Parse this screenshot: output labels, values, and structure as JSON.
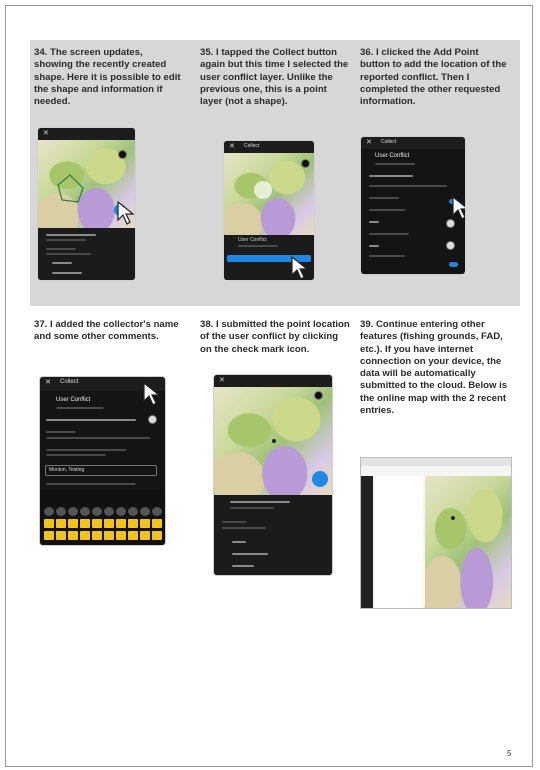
{
  "steps": [
    {
      "text": "34. The screen updates, showing the recently created shape. Here it is possible to edit the shape and information if needed."
    },
    {
      "text": "35. I tapped the Collect button again but this time I selected the user conflict layer. Unlike the previous one, this is a point layer (not a shape)."
    },
    {
      "text": "36. I clicked the Add Point button to add the location of the reported conflict. Then I completed the other requested information."
    },
    {
      "text": "37. I added the collector's name and some other comments."
    },
    {
      "text": "38. I submitted the point location of the user conflict by clicking on the check mark icon."
    },
    {
      "text": "39. Continue entering other features (fishing grounds, FAD, etc.). If you have internet connection on your device, the data will be automatically submitted to the cloud. Below is the online map with the 2 recent entries."
    }
  ],
  "screens": {
    "collect_title": "Collect",
    "user_conflict": "User Conflict",
    "close_glyph": "✕",
    "collector_value": "Monton, Testing"
  },
  "page_number": "5",
  "colors": {
    "accent": "#1e88e5",
    "band": "#d7d7d7",
    "keyboard_keys": "#f2c318"
  },
  "icons": [
    "close-icon",
    "check-icon",
    "cursor-pointer-icon",
    "map-pin-icon",
    "locate-icon"
  ]
}
